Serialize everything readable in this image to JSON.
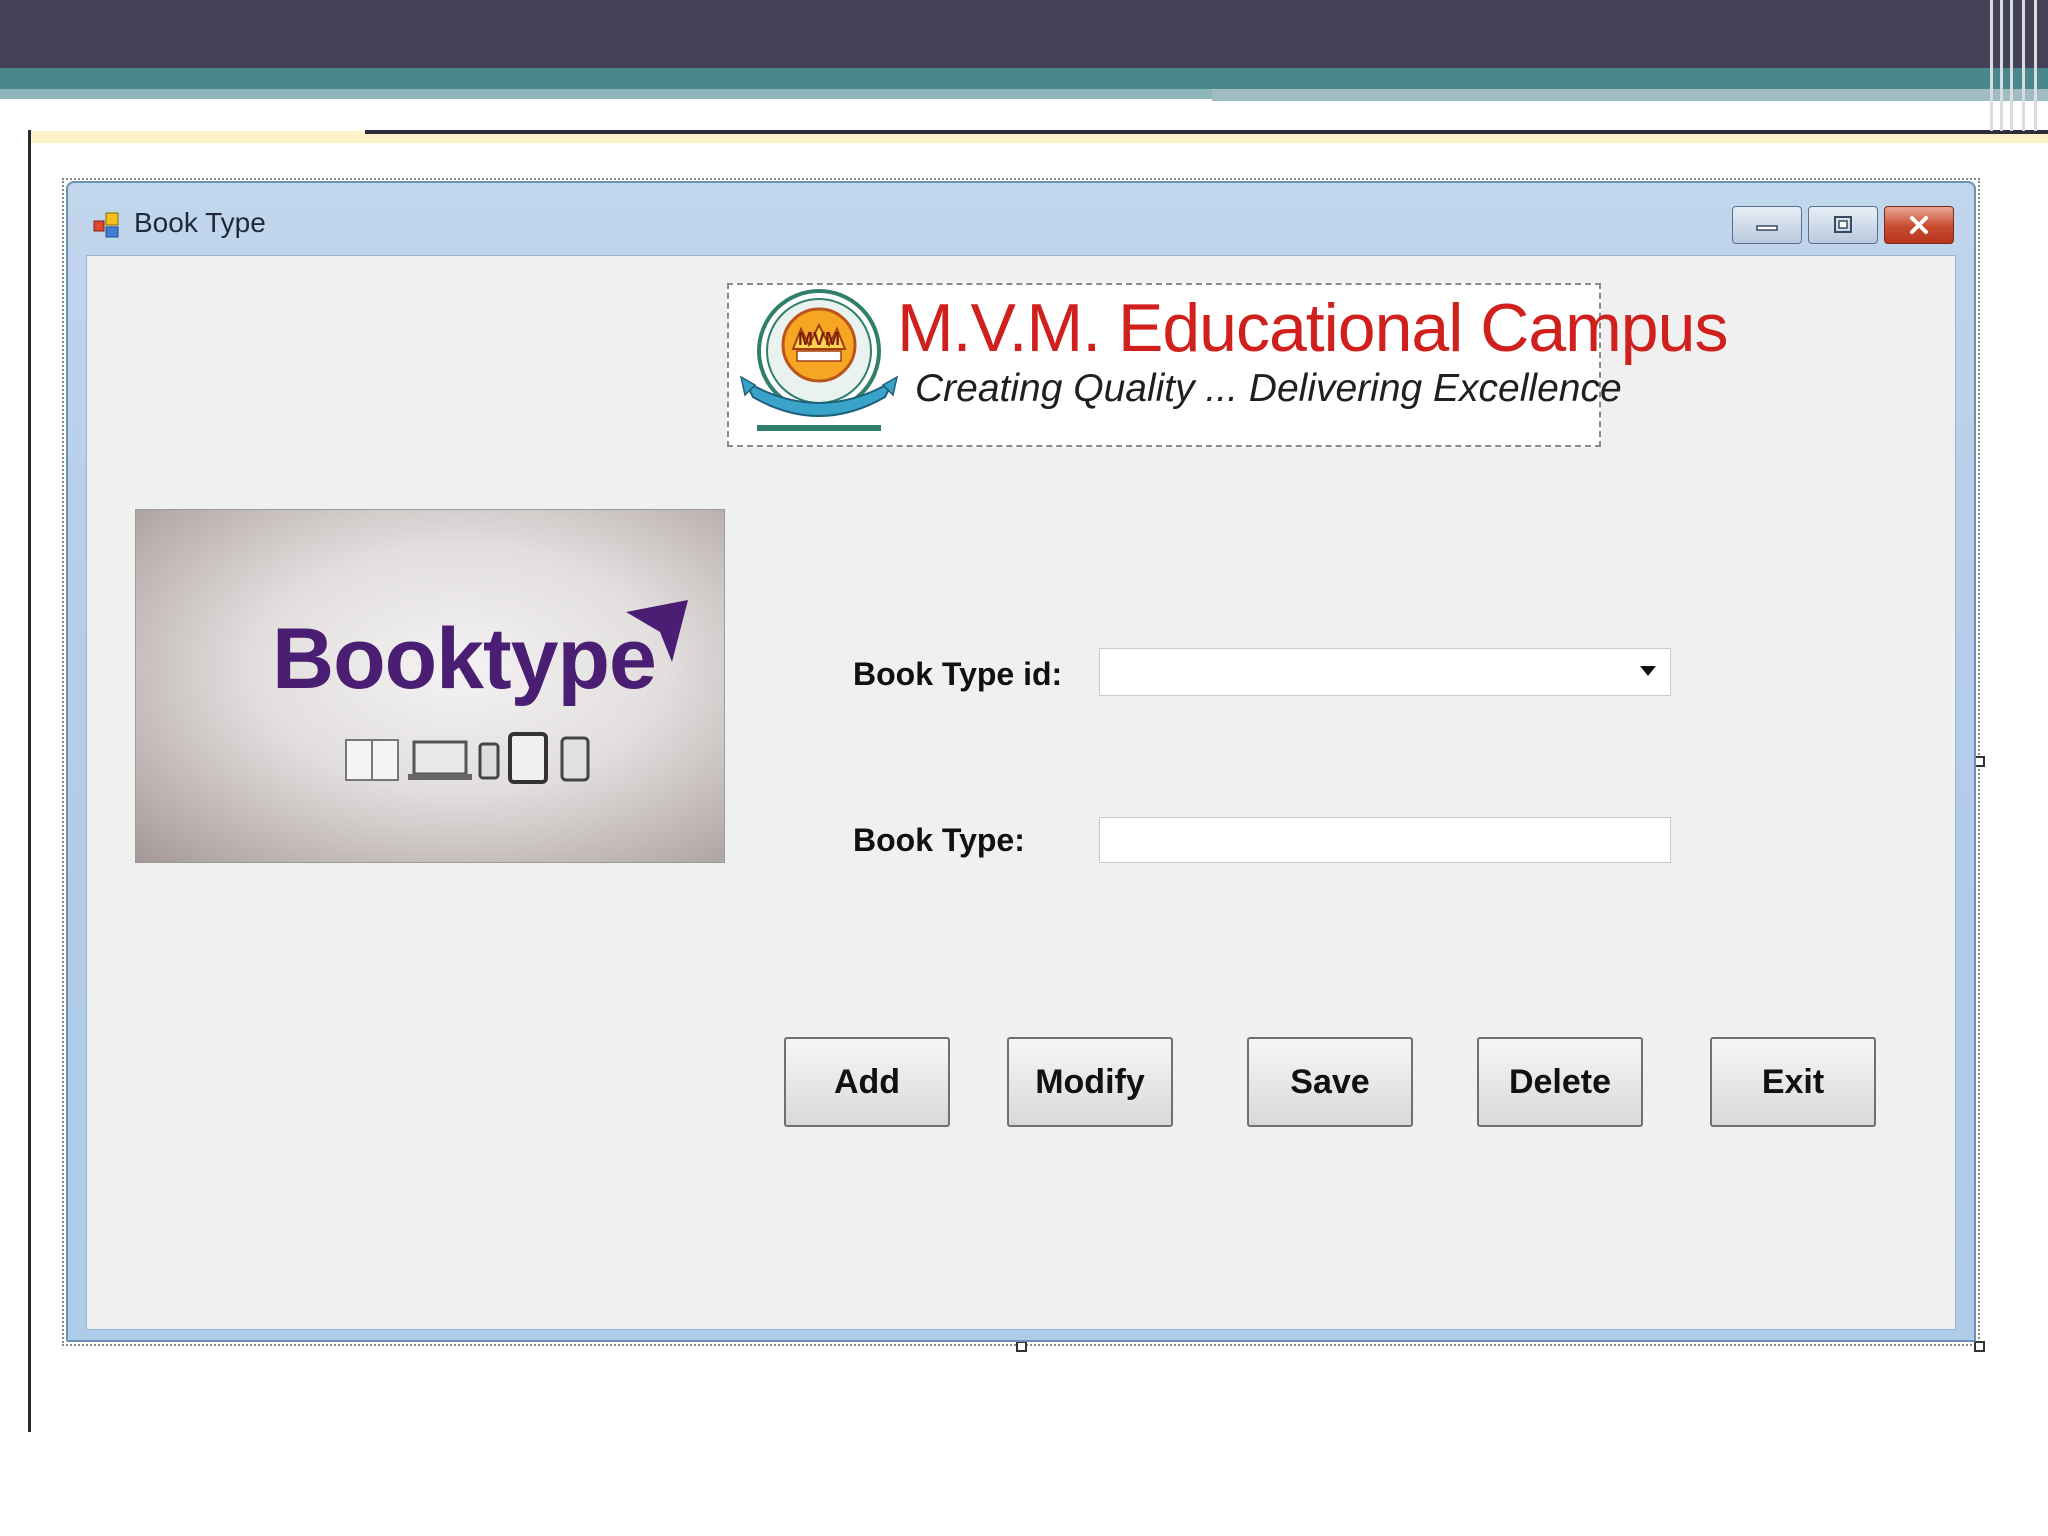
{
  "window": {
    "title": "Book Type"
  },
  "banner": {
    "campus_name": "M.V.M. Educational Campus",
    "tagline": "Creating Quality ... Delivering Excellence",
    "seal_text": "MVM"
  },
  "image": {
    "brand_word": "Booktype",
    "brand_color": "#4a1e73"
  },
  "form": {
    "book_type_id_label": "Book Type id:",
    "book_type_id_value": "",
    "book_type_label": "Book Type:",
    "book_type_value": ""
  },
  "buttons": {
    "add": "Add",
    "modify": "Modify",
    "save": "Save",
    "delete": "Delete",
    "exit": "Exit"
  },
  "colors": {
    "campus_red": "#d0201e",
    "window_frame": "#b5cde8",
    "close_button": "#c74a2f"
  }
}
